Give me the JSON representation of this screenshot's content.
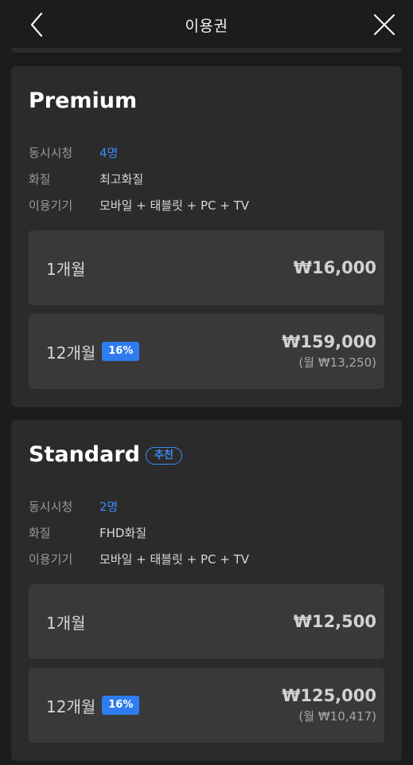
{
  "header": {
    "title": "이용권",
    "back_icon": "chevron-left-icon",
    "close_icon": "close-icon"
  },
  "colors": {
    "background": "#1c1c1c",
    "card": "#2b2b2b",
    "option": "#393939",
    "accent": "#3b8bf5"
  },
  "plans": [
    {
      "name": "Premium",
      "badge": "",
      "features": [
        {
          "label": "동시시청",
          "value": "4명"
        },
        {
          "label": "화질",
          "value": "최고화질"
        },
        {
          "label": "이용기기",
          "value": "모바일 + 태블릿 + PC + TV"
        }
      ],
      "options": [
        {
          "period": "1개월",
          "discount": "",
          "price": "₩16,000",
          "monthly": ""
        },
        {
          "period": "12개월",
          "discount": "16%",
          "price": "₩159,000",
          "monthly": "(월 ₩13,250)"
        }
      ]
    },
    {
      "name": "Standard",
      "badge": "추천",
      "features": [
        {
          "label": "동시시청",
          "value": "2명"
        },
        {
          "label": "화질",
          "value": "FHD화질"
        },
        {
          "label": "이용기기",
          "value": "모바일 + 태블릿 + PC + TV"
        }
      ],
      "options": [
        {
          "period": "1개월",
          "discount": "",
          "price": "₩12,500",
          "monthly": ""
        },
        {
          "period": "12개월",
          "discount": "16%",
          "price": "₩125,000",
          "monthly": "(월 ₩10,417)"
        }
      ]
    }
  ]
}
